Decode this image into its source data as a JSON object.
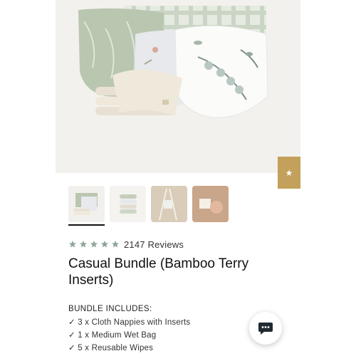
{
  "product": {
    "title": "Casual Bundle (Bamboo Terry Inserts)",
    "rating": 5,
    "reviews_label": "2147 Reviews"
  },
  "gallery": {
    "thumbnails": [
      {
        "name": "thumb-bundle"
      },
      {
        "name": "thumb-nappies-stack"
      },
      {
        "name": "thumb-drying-rack"
      },
      {
        "name": "thumb-hand-wipe"
      }
    ],
    "active_index": 0
  },
  "bundle": {
    "heading": "BUNDLE INCLUDES:",
    "items": [
      "✓ 3 x Cloth Nappies with Inserts",
      "✓ 1 x Medium Wet Bag",
      "✓ 5 x Reusable Wipes"
    ]
  },
  "side_tab": {
    "icon": "star-icon",
    "color": "#c3a05c"
  },
  "chat": {
    "icon": "chat-icon"
  },
  "colors": {
    "star": "#8fa79a",
    "accent": "#c3a05c",
    "text": "#111111"
  }
}
